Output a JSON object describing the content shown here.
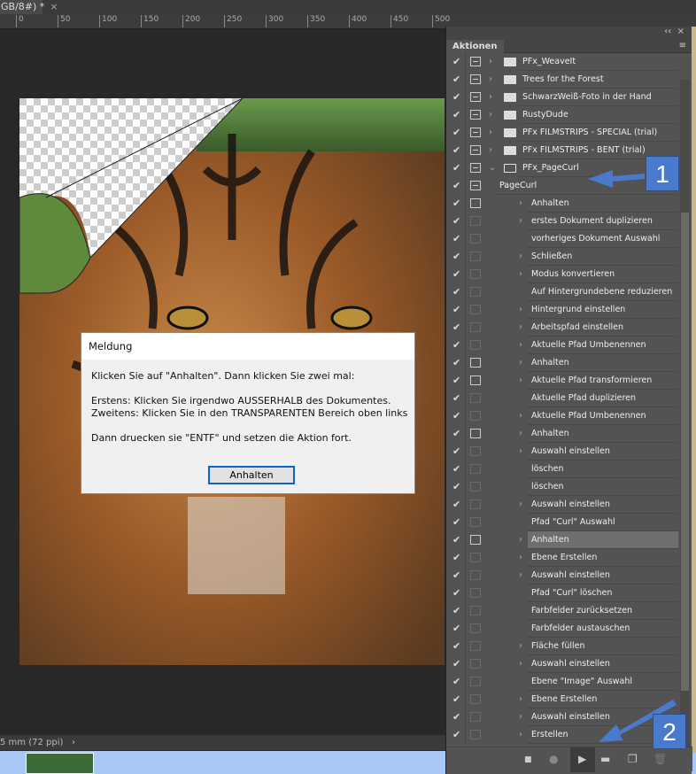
{
  "document": {
    "tab_title": "GB/8#) *",
    "close": "×",
    "status": "5 mm (72 ppi)",
    "status_arrow": "›"
  },
  "ruler": [
    "0",
    "50",
    "100",
    "150",
    "200",
    "250",
    "300",
    "350",
    "400",
    "450",
    "500"
  ],
  "panel": {
    "collapse": "‹‹",
    "close": "×",
    "tab": "Aktionen",
    "menu": "≡",
    "rows": [
      {
        "label": "PFx_WeaveIt",
        "level": 0,
        "type": "set",
        "dialog": "bar",
        "toggle": "›"
      },
      {
        "label": "Trees for the Forest",
        "level": 0,
        "type": "set",
        "dialog": "bar",
        "toggle": "›"
      },
      {
        "label": "SchwarzWeiß-Foto in der Hand",
        "level": 0,
        "type": "set",
        "dialog": "bar",
        "toggle": "›"
      },
      {
        "label": "RustyDude",
        "level": 0,
        "type": "set",
        "dialog": "bar",
        "toggle": "›"
      },
      {
        "label": "PFx FILMSTRIPS - SPECIAL (trial)",
        "level": 0,
        "type": "set",
        "dialog": "bar",
        "toggle": "›"
      },
      {
        "label": "PFx FILMSTRIPS - BENT (trial)",
        "level": 0,
        "type": "set",
        "dialog": "bar",
        "toggle": "›"
      },
      {
        "label": "PFx_PageCurl",
        "level": 0,
        "type": "set-open",
        "dialog": "bar",
        "toggle": "⌄"
      },
      {
        "label": "PageCurl",
        "level": 1,
        "dialog": "bar",
        "toggle": "⌄"
      },
      {
        "label": "Anhalten",
        "level": 2,
        "dialog": "on",
        "toggle": "›"
      },
      {
        "label": "erstes Dokument duplizieren",
        "level": 2,
        "dialog": "dim",
        "toggle": "›"
      },
      {
        "label": "vorheriges Dokument Auswahl",
        "level": 2,
        "dialog": "dim",
        "toggle": ""
      },
      {
        "label": "Schließen",
        "level": 2,
        "dialog": "dim",
        "toggle": "›"
      },
      {
        "label": "Modus konvertieren",
        "level": 2,
        "dialog": "dim",
        "toggle": "›"
      },
      {
        "label": "Auf Hintergrundebene reduzieren",
        "level": 2,
        "dialog": "dim",
        "toggle": ""
      },
      {
        "label": "Hintergrund einstellen",
        "level": 2,
        "dialog": "dim",
        "toggle": "›"
      },
      {
        "label": "Arbeitspfad einstellen",
        "level": 2,
        "dialog": "dim",
        "toggle": "›"
      },
      {
        "label": "Aktuelle Pfad Umbenennen",
        "level": 2,
        "dialog": "dim",
        "toggle": "›"
      },
      {
        "label": "Anhalten",
        "level": 2,
        "dialog": "on",
        "toggle": "›"
      },
      {
        "label": "Aktuelle Pfad transformieren",
        "level": 2,
        "dialog": "on",
        "toggle": "›"
      },
      {
        "label": "Aktuelle Pfad duplizieren",
        "level": 2,
        "dialog": "dim",
        "toggle": ""
      },
      {
        "label": "Aktuelle Pfad Umbenennen",
        "level": 2,
        "dialog": "dim",
        "toggle": "›"
      },
      {
        "label": "Anhalten",
        "level": 2,
        "dialog": "on",
        "toggle": "›"
      },
      {
        "label": "Auswahl einstellen",
        "level": 2,
        "dialog": "dim",
        "toggle": "›"
      },
      {
        "label": "löschen",
        "level": 2,
        "dialog": "dim",
        "toggle": ""
      },
      {
        "label": "löschen",
        "level": 2,
        "dialog": "dim",
        "toggle": ""
      },
      {
        "label": "Auswahl einstellen",
        "level": 2,
        "dialog": "dim",
        "toggle": "›"
      },
      {
        "label": "Pfad \"Curl\" Auswahl",
        "level": 2,
        "dialog": "dim",
        "toggle": ""
      },
      {
        "label": "Anhalten",
        "level": 2,
        "dialog": "on",
        "toggle": "›",
        "selected": true
      },
      {
        "label": "Ebene Erstellen",
        "level": 2,
        "dialog": "dim",
        "toggle": "›"
      },
      {
        "label": "Auswahl einstellen",
        "level": 2,
        "dialog": "dim",
        "toggle": "›"
      },
      {
        "label": "Pfad \"Curl\" löschen",
        "level": 2,
        "dialog": "dim",
        "toggle": ""
      },
      {
        "label": "Farbfelder zurücksetzen",
        "level": 2,
        "dialog": "dim",
        "toggle": ""
      },
      {
        "label": "Farbfelder austauschen",
        "level": 2,
        "dialog": "dim",
        "toggle": ""
      },
      {
        "label": "Fläche füllen",
        "level": 2,
        "dialog": "dim",
        "toggle": "›"
      },
      {
        "label": "Auswahl einstellen",
        "level": 2,
        "dialog": "dim",
        "toggle": "›"
      },
      {
        "label": "Ebene \"Image\" Auswahl",
        "level": 2,
        "dialog": "dim",
        "toggle": ""
      },
      {
        "label": "Ebene Erstellen",
        "level": 2,
        "dialog": "dim",
        "toggle": "›"
      },
      {
        "label": "Auswahl einstellen",
        "level": 2,
        "dialog": "dim",
        "toggle": "›"
      },
      {
        "label": "Erstellen",
        "level": 2,
        "dialog": "dim",
        "toggle": "›"
      }
    ],
    "toolbar": {
      "stop": "■",
      "record": "●",
      "play": "▶",
      "new_set": "▬",
      "new_action": "❐",
      "delete": "🗑"
    }
  },
  "callouts": [
    "1",
    "2"
  ],
  "callout_color": "#4a7acb",
  "dialog": {
    "title": "Meldung",
    "line1": "Klicken Sie auf \"Anhalten\". Dann klicken Sie zwei mal:",
    "line2": "Erstens: Klicken Sie irgendwo AUSSERHALB des Dokumentes.",
    "line3": "Zweitens: Klicken Sie in den TRANSPARENTEN Bereich oben links",
    "line4": "Dann druecken sie \"ENTF\" und setzen die Aktion fort.",
    "button": "Anhalten"
  }
}
